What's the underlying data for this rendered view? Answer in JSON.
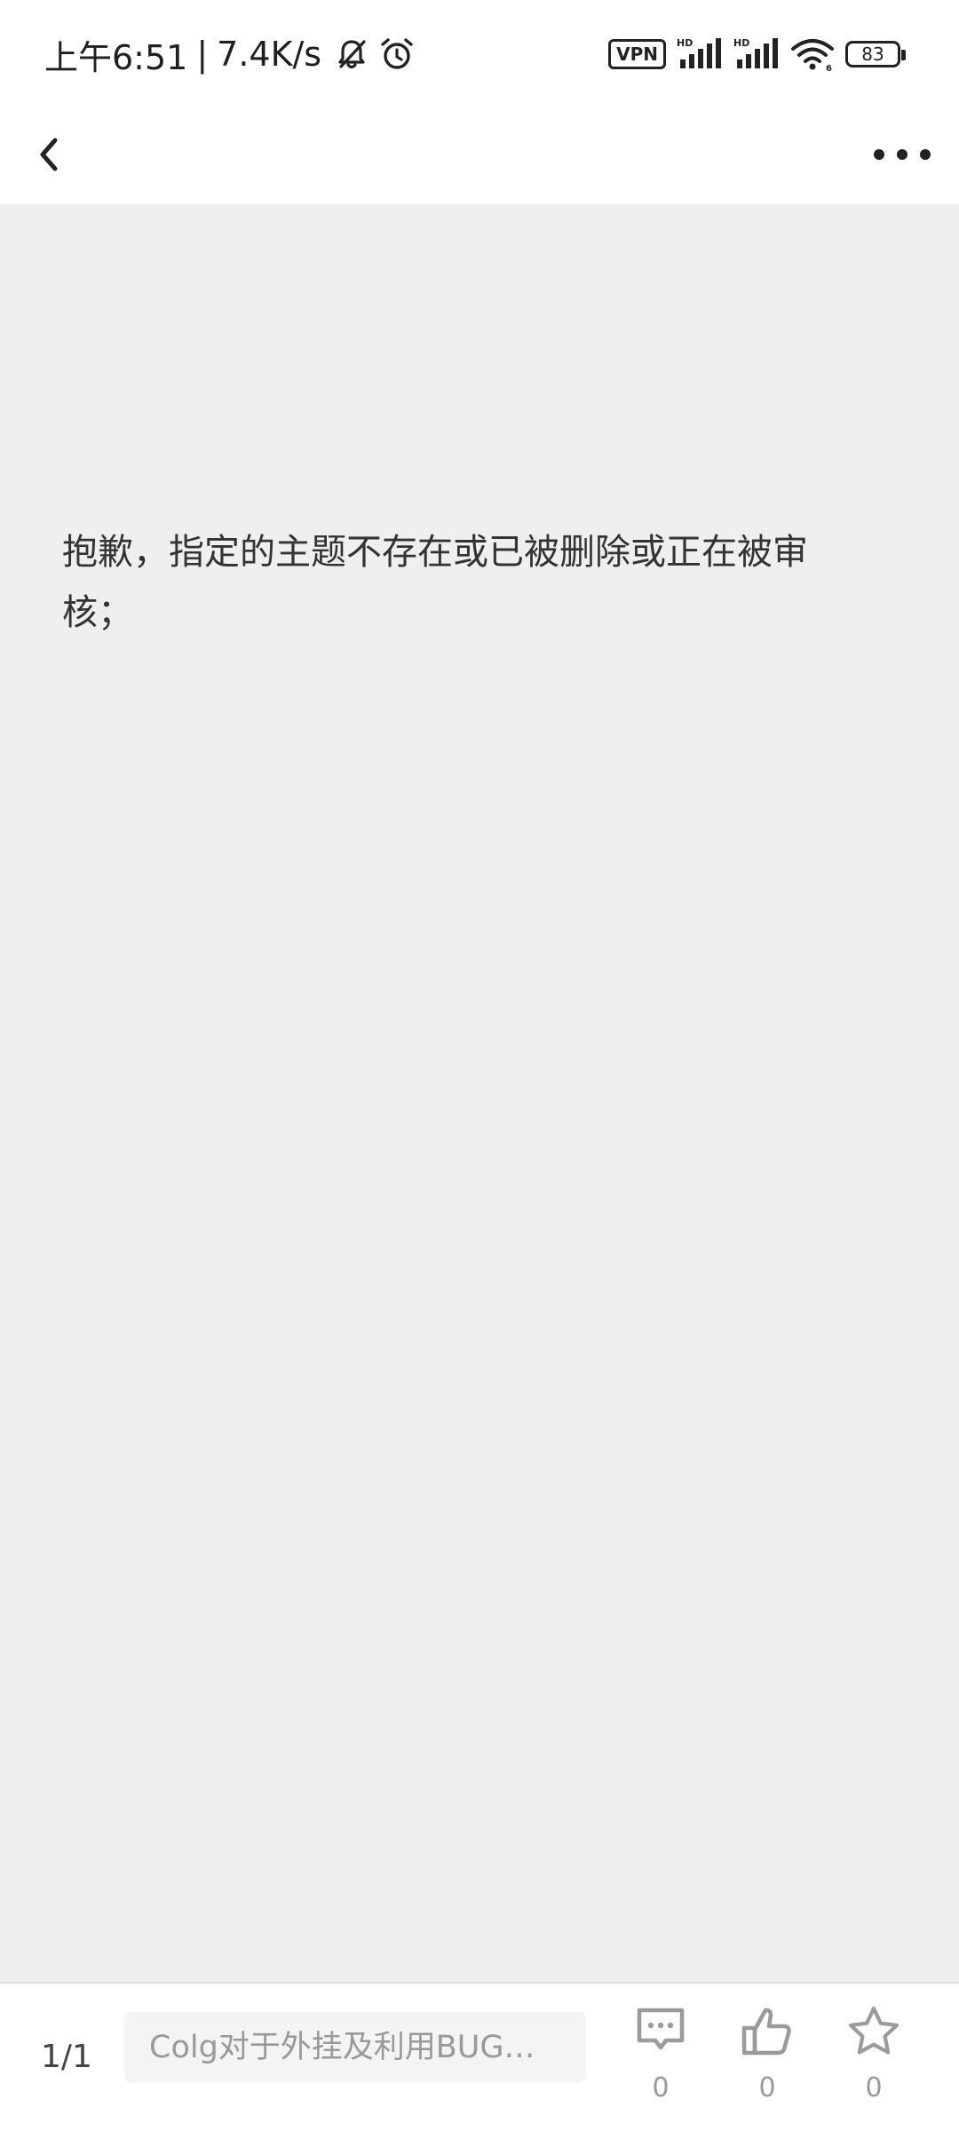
{
  "status_bar": {
    "time": "上午6:51",
    "separator": "|",
    "speed": "7.4K/s",
    "vpn": "VPN",
    "battery": "83",
    "icons": [
      "bell-off-icon",
      "alarm-icon",
      "vpn-icon",
      "signal-hd-icon",
      "signal-hd-icon",
      "wifi-icon",
      "battery-icon"
    ]
  },
  "nav": {
    "back_icon": "chevron-left-icon",
    "more_icon": "more-horizontal-icon"
  },
  "content": {
    "message": "抱歉，指定的主题不存在或已被删除或正在被审核；"
  },
  "bottom_bar": {
    "page_indicator": "1/1",
    "reply_placeholder": "Colg对于外挂及利用BUG进...",
    "comment_count": "0",
    "like_count": "0",
    "favorite_count": "0"
  },
  "colors": {
    "content_bg": "#efefef",
    "icon_gray": "#999999",
    "text_dark": "#333333"
  }
}
